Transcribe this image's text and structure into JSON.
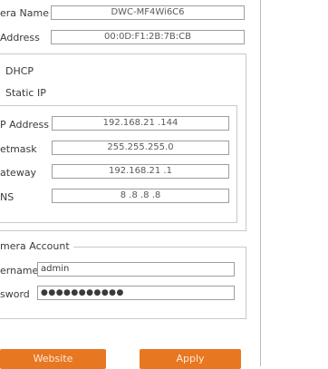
{
  "top": {
    "camera_name_label": "era Name",
    "camera_name_value": "DWC-MF4Wi6C6",
    "mac_label": "Address",
    "mac_value": "00:0D:F1:2B:7B:CB"
  },
  "network": {
    "dhcp_label": "DHCP",
    "static_label": "Static IP",
    "ip_label": "P Address",
    "ip_value": "192.168.21 .144",
    "netmask_label": "etmask",
    "netmask_value": "255.255.255.0",
    "gateway_label": "ateway",
    "gateway_value": "192.168.21 .1",
    "dns_label": "NS",
    "dns_value": "8 .8 .8 .8"
  },
  "account": {
    "legend": "mera Account",
    "username_label": "ername",
    "username_value": "admin",
    "password_label": "sword",
    "password_value": "●●●●●●●●●●●"
  },
  "buttons": {
    "website": "Website",
    "apply": "Apply"
  }
}
